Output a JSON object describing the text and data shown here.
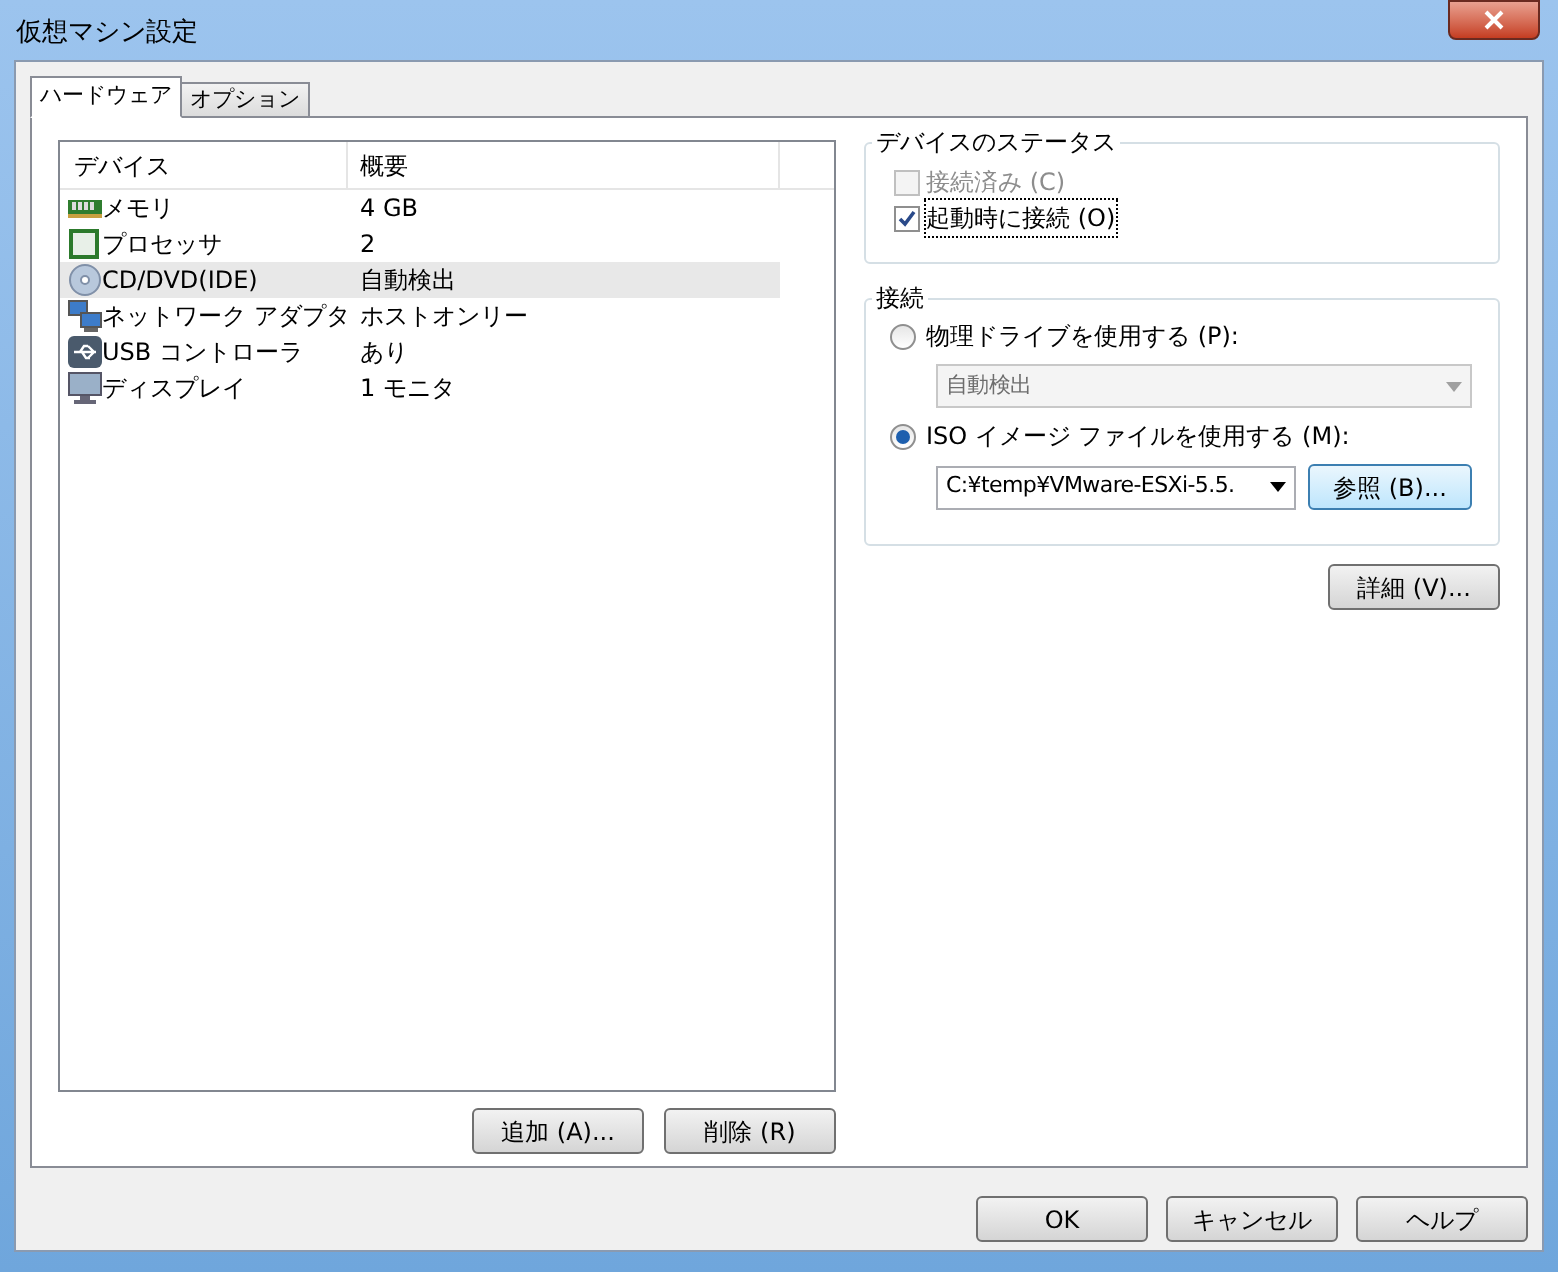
{
  "window": {
    "title": "仮想マシン設定"
  },
  "tabs": [
    {
      "label": "ハードウェア",
      "selected": true
    },
    {
      "label": "オプション",
      "selected": false
    }
  ],
  "device_list": {
    "columns": [
      "デバイス",
      "概要"
    ],
    "rows": [
      {
        "kind": "memory",
        "device": "メモリ",
        "summary": "4 GB",
        "selected": false
      },
      {
        "kind": "processor",
        "device": "プロセッサ",
        "summary": "2",
        "selected": false
      },
      {
        "kind": "disc",
        "device": "CD/DVD(IDE)",
        "summary": "自動検出",
        "selected": true
      },
      {
        "kind": "network",
        "device": "ネットワーク アダプタ",
        "summary": "ホストオンリー",
        "selected": false
      },
      {
        "kind": "usb",
        "device": "USB コントローラ",
        "summary": "あり",
        "selected": false
      },
      {
        "kind": "display",
        "device": "ディスプレイ",
        "summary": "1 モニタ",
        "selected": false
      }
    ]
  },
  "list_buttons": [
    "追加 (A)...",
    "削除 (R)"
  ],
  "device_status": {
    "title": "デバイスのステータス",
    "options": [
      {
        "label": "接続済み (C)",
        "checked": false,
        "disabled": true,
        "focused": false
      },
      {
        "label": "起動時に接続 (O)",
        "checked": true,
        "disabled": false,
        "focused": true
      }
    ]
  },
  "connection": {
    "title": "接続",
    "sources": [
      {
        "label": "物理ドライブを使用する (P):",
        "selected": false,
        "value": "自動検出"
      },
      {
        "label": "ISO イメージ ファイルを使用する (M):",
        "selected": true,
        "value": "C:¥temp¥VMware-ESXi-5.5.",
        "button": "参照 (B)..."
      }
    ]
  },
  "advanced_button": "詳細 (V)...",
  "dialog_buttons": [
    "OK",
    "キャンセル",
    "ヘルプ"
  ]
}
